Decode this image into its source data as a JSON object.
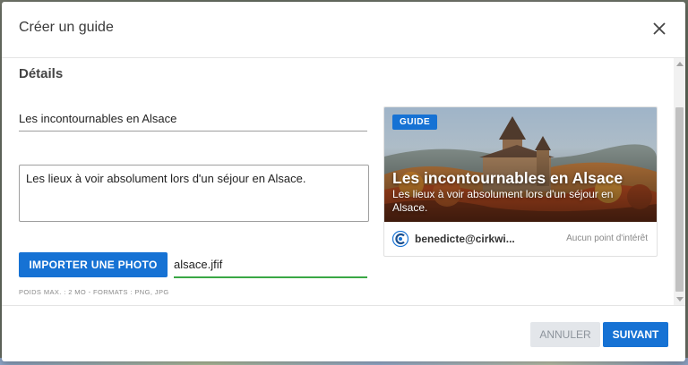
{
  "dialog": {
    "title": "Créer un guide"
  },
  "details": {
    "section_title": "Détails",
    "title_value": "Les incontournables en Alsace",
    "description_value": "Les lieux à voir absolument lors d'un séjour en Alsace.",
    "import_button_label": "IMPORTER UNE PHOTO",
    "file_name": "alsace.jfif",
    "file_hint": "POIDS MAX. : 2 MO - FORMATS : PNG, JPG"
  },
  "preview": {
    "badge": "GUIDE",
    "title": "Les incontournables en Alsace",
    "description": "Les lieux à voir absolument lors d'un séjour en Alsace.",
    "author": "benedicte@cirkwi....",
    "poi_count": "Aucun point d'intérêt"
  },
  "footer": {
    "cancel_label": "ANNULER",
    "next_label": "SUIVANT"
  },
  "icons": {
    "close": "close-icon",
    "avatar": "avatar-icon"
  },
  "colors": {
    "primary": "#1672d4",
    "success_underline": "#3aa745",
    "cancel_bg": "#e3e6ea"
  }
}
